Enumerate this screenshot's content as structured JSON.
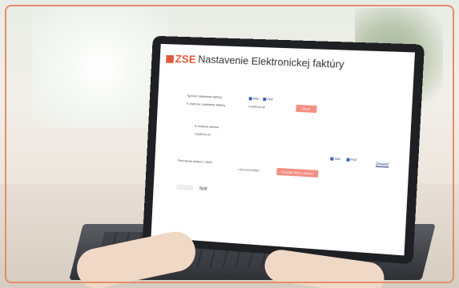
{
  "brand": {
    "logo_text": "ZSE",
    "color": "#e35a3b"
  },
  "page": {
    "title": "Nastavenie Elektronickej faktúry"
  },
  "form": {
    "invoice_format_label": "Spôsob zasielania faktúry",
    "format_xml": "XML",
    "format_pdf": "PDF",
    "email_label": "E-mail pre zasielanie faktúry",
    "email_value": "my@test.sk",
    "save_button": "Uložiť",
    "email_address_label": "E-mailová adresa",
    "email_address_value": "my@test.sk",
    "format2_xml": "XML",
    "format2_pdf": "PDF",
    "change_link": "Zmeniť",
    "sms_label": "Potvrdenie kódom z SMS",
    "phone_value": "+421911234567",
    "send_code_button": "Odoslať SMS s kódom",
    "back_label": "Späť"
  }
}
